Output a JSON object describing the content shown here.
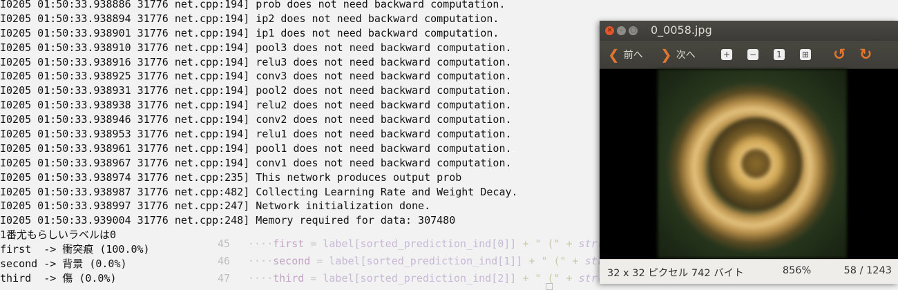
{
  "terminal": {
    "lines": [
      "I0205 01:50:33.938886 31776 net.cpp:194] prob does not need backward computation.",
      "I0205 01:50:33.938894 31776 net.cpp:194] ip2 does not need backward computation.",
      "I0205 01:50:33.938901 31776 net.cpp:194] ip1 does not need backward computation.",
      "I0205 01:50:33.938910 31776 net.cpp:194] pool3 does not need backward computation.",
      "I0205 01:50:33.938916 31776 net.cpp:194] relu3 does not need backward computation.",
      "I0205 01:50:33.938925 31776 net.cpp:194] conv3 does not need backward computation.",
      "I0205 01:50:33.938931 31776 net.cpp:194] pool2 does not need backward computation.",
      "I0205 01:50:33.938938 31776 net.cpp:194] relu2 does not need backward computation.",
      "I0205 01:50:33.938946 31776 net.cpp:194] conv2 does not need backward computation.",
      "I0205 01:50:33.938953 31776 net.cpp:194] relu1 does not need backward computation.",
      "I0205 01:50:33.938961 31776 net.cpp:194] pool1 does not need backward computation.",
      "I0205 01:50:33.938967 31776 net.cpp:194] conv1 does not need backward computation.",
      "I0205 01:50:33.938974 31776 net.cpp:235] This network produces output prob",
      "I0205 01:50:33.938987 31776 net.cpp:482] Collecting Learning Rate and Weight Decay.",
      "I0205 01:50:33.938997 31776 net.cpp:247] Network initialization done.",
      "I0205 01:50:33.939004 31776 net.cpp:248] Memory required for data: 307480",
      "1番尤もらしいラベルは0",
      "first  -> 衝突痕 (100.0%)",
      "second -> 背景 (0.0%)",
      "third  -> 傷 (0.0%)"
    ]
  },
  "editor": {
    "lines": [
      {
        "num": "45",
        "dots": "····",
        "kw": "first",
        "eq": " = ",
        "tx": "label[sorted_prediction_ind[0]]",
        "rest": " + \" (\" + ",
        "fn": "str("
      },
      {
        "num": "46",
        "dots": "····",
        "kw": "second",
        "eq": " = ",
        "tx": "label[sorted_prediction_ind[1]]",
        "rest": " + \" (\" + ",
        "fn": "str("
      },
      {
        "num": "47",
        "dots": "····",
        "kw": "third",
        "eq": " = ",
        "tx": "label[sorted_prediction_ind[2]]",
        "rest": " + \" (\" + ",
        "fn": "str("
      }
    ]
  },
  "viewer": {
    "title": "0_0058.jpg",
    "prev_label": "前へ",
    "next_label": "次へ",
    "status_left": "32 x 32 ピクセル 742 バイト",
    "zoom": "856%",
    "position": "58 / 1243",
    "accent_color": "#e2762f"
  }
}
